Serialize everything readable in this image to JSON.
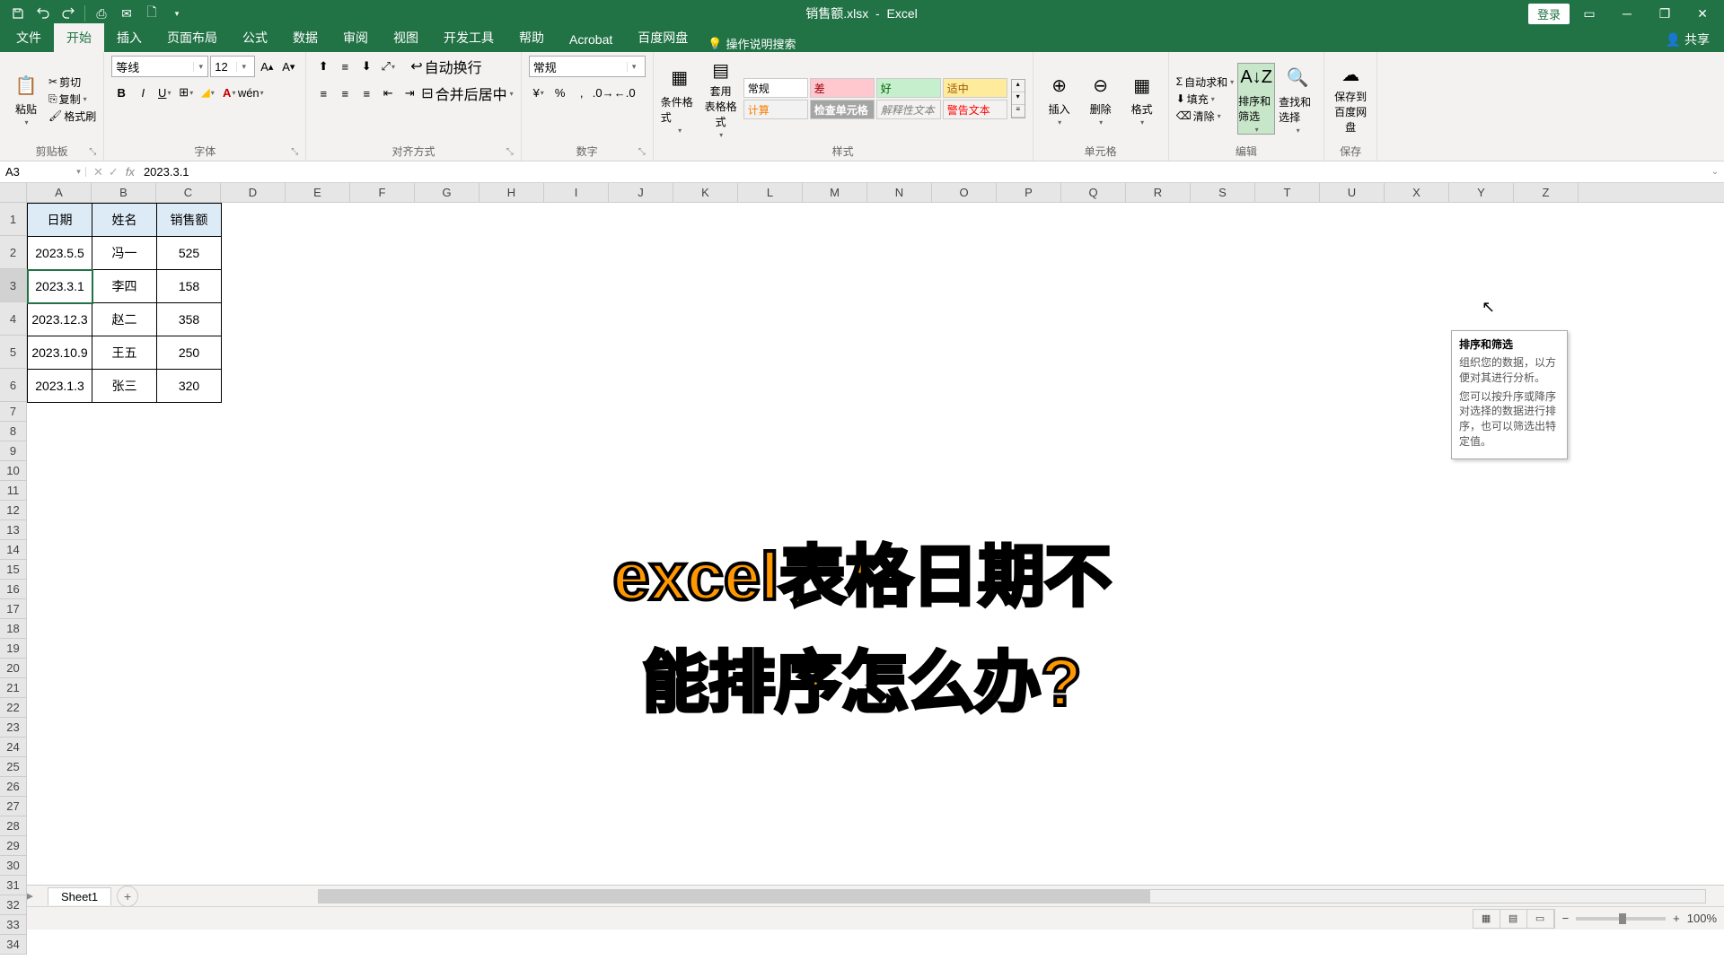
{
  "titlebar": {
    "filename": "销售额.xlsx",
    "app": "Excel",
    "login": "登录"
  },
  "tabs": {
    "file": "文件",
    "home": "开始",
    "insert": "插入",
    "layout": "页面布局",
    "formulas": "公式",
    "data": "数据",
    "review": "审阅",
    "view": "视图",
    "dev": "开发工具",
    "help": "帮助",
    "acrobat": "Acrobat",
    "baidu": "百度网盘",
    "tellme": "操作说明搜索",
    "share": "共享"
  },
  "ribbon": {
    "clipboard": {
      "paste": "粘贴",
      "cut": "剪切",
      "copy": "复制",
      "painter": "格式刷",
      "label": "剪贴板"
    },
    "font": {
      "name": "等线",
      "size": "12",
      "label": "字体"
    },
    "align": {
      "wrap": "自动换行",
      "merge": "合并后居中",
      "label": "对齐方式"
    },
    "number": {
      "format": "常规",
      "label": "数字"
    },
    "styles": {
      "cond": "条件格式",
      "table": "套用\n表格格式",
      "normal": "常规",
      "bad": "差",
      "good": "好",
      "neutral": "适中",
      "calc": "计算",
      "check": "检查单元格",
      "explain": "解释性文本",
      "warning": "警告文本",
      "label": "样式"
    },
    "cells": {
      "insert": "插入",
      "delete": "删除",
      "format": "格式",
      "label": "单元格"
    },
    "editing": {
      "autosum": "自动求和",
      "fill": "填充",
      "clear": "清除",
      "sort": "排序和筛选",
      "find": "查找和选择",
      "label": "编辑"
    },
    "save": {
      "baidu": "保存到\n百度网盘",
      "label": "保存"
    }
  },
  "namebox": "A3",
  "formula": "2023.3.1",
  "columns": [
    "A",
    "B",
    "C",
    "D",
    "E",
    "F",
    "G",
    "H",
    "I",
    "J",
    "K",
    "L",
    "M",
    "N",
    "O",
    "P",
    "Q",
    "R",
    "S",
    "T",
    "U",
    "X",
    "Y",
    "Z"
  ],
  "headers": {
    "date": "日期",
    "name": "姓名",
    "sales": "销售额"
  },
  "rows": [
    {
      "date": "2023.5.5",
      "name": "冯一",
      "sales": "525"
    },
    {
      "date": "2023.3.1",
      "name": "李四",
      "sales": "158"
    },
    {
      "date": "2023.12.3",
      "name": "赵二",
      "sales": "358"
    },
    {
      "date": "2023.10.9",
      "name": "王五",
      "sales": "250"
    },
    {
      "date": "2023.1.3",
      "name": "张三",
      "sales": "320"
    }
  ],
  "overlay": {
    "line1": "excel表格日期不",
    "line2": "能排序怎么办?"
  },
  "tooltip": {
    "title": "排序和筛选",
    "desc1": "组织您的数据，以方便对其进行分析。",
    "desc2": "您可以按升序或降序对选择的数据进行排序，也可以筛选出特定值。"
  },
  "sheet": {
    "name": "Sheet1"
  },
  "status": {
    "zoom": "100%",
    "ready": ""
  }
}
